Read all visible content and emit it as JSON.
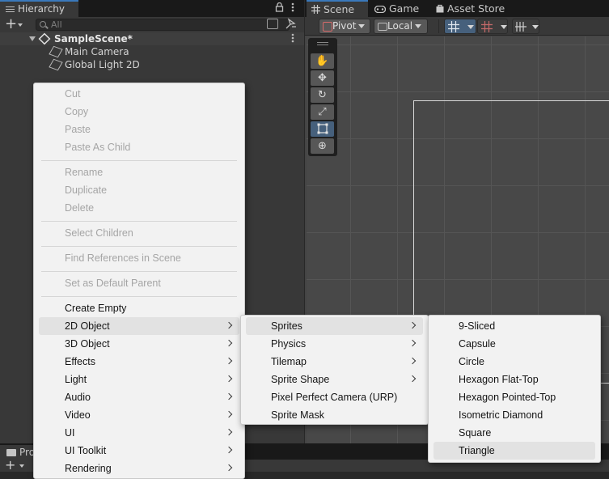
{
  "hierarchy": {
    "tab_label": "Hierarchy",
    "search_placeholder": "All",
    "scene_name": "SampleScene*",
    "objects": [
      {
        "label": "Main Camera"
      },
      {
        "label": "Global Light 2D"
      }
    ]
  },
  "scene_panel": {
    "tabs": [
      {
        "label": "Scene",
        "icon": "grid-icon"
      },
      {
        "label": "Game",
        "icon": "gamepad-icon"
      },
      {
        "label": "Asset Store",
        "icon": "bag-icon"
      }
    ],
    "pivot_label": "Pivot",
    "local_label": "Local",
    "tools": [
      "hand-tool-icon",
      "move-tool-icon",
      "rotate-tool-icon",
      "scale-tool-icon",
      "rect-tool-icon",
      "transform-tool-icon"
    ],
    "active_tool": "rect-tool-icon"
  },
  "project_panel": {
    "tab_label": "Pro"
  },
  "context_menu": {
    "groups": [
      [
        {
          "label": "Cut",
          "disabled": true
        },
        {
          "label": "Copy",
          "disabled": true
        },
        {
          "label": "Paste",
          "disabled": true
        },
        {
          "label": "Paste As Child",
          "disabled": true
        }
      ],
      [
        {
          "label": "Rename",
          "disabled": true
        },
        {
          "label": "Duplicate",
          "disabled": true
        },
        {
          "label": "Delete",
          "disabled": true
        }
      ],
      [
        {
          "label": "Select Children",
          "disabled": true
        }
      ],
      [
        {
          "label": "Find References in Scene",
          "disabled": true
        }
      ],
      [
        {
          "label": "Set as Default Parent",
          "disabled": true
        }
      ],
      [
        {
          "label": "Create Empty",
          "disabled": false
        },
        {
          "label": "2D Object",
          "disabled": false,
          "submenu": true,
          "highlighted": true
        },
        {
          "label": "3D Object",
          "disabled": false,
          "submenu": true
        },
        {
          "label": "Effects",
          "disabled": false,
          "submenu": true
        },
        {
          "label": "Light",
          "disabled": false,
          "submenu": true
        },
        {
          "label": "Audio",
          "disabled": false,
          "submenu": true
        },
        {
          "label": "Video",
          "disabled": false,
          "submenu": true
        },
        {
          "label": "UI",
          "disabled": false,
          "submenu": true
        },
        {
          "label": "UI Toolkit",
          "disabled": false,
          "submenu": true
        },
        {
          "label": "Rendering",
          "disabled": false,
          "submenu": true
        }
      ]
    ]
  },
  "submenu_2d_object": {
    "items": [
      {
        "label": "Sprites",
        "submenu": true,
        "highlighted": true
      },
      {
        "label": "Physics",
        "submenu": true
      },
      {
        "label": "Tilemap",
        "submenu": true
      },
      {
        "label": "Sprite Shape",
        "submenu": true
      },
      {
        "label": "Pixel Perfect Camera (URP)",
        "submenu": false
      },
      {
        "label": "Sprite Mask",
        "submenu": false
      }
    ]
  },
  "submenu_sprites": {
    "items": [
      {
        "label": "9-Sliced"
      },
      {
        "label": "Capsule"
      },
      {
        "label": "Circle"
      },
      {
        "label": "Hexagon Flat-Top"
      },
      {
        "label": "Hexagon Pointed-Top"
      },
      {
        "label": "Isometric Diamond"
      },
      {
        "label": "Square"
      },
      {
        "label": "Triangle",
        "highlighted": true
      }
    ]
  }
}
